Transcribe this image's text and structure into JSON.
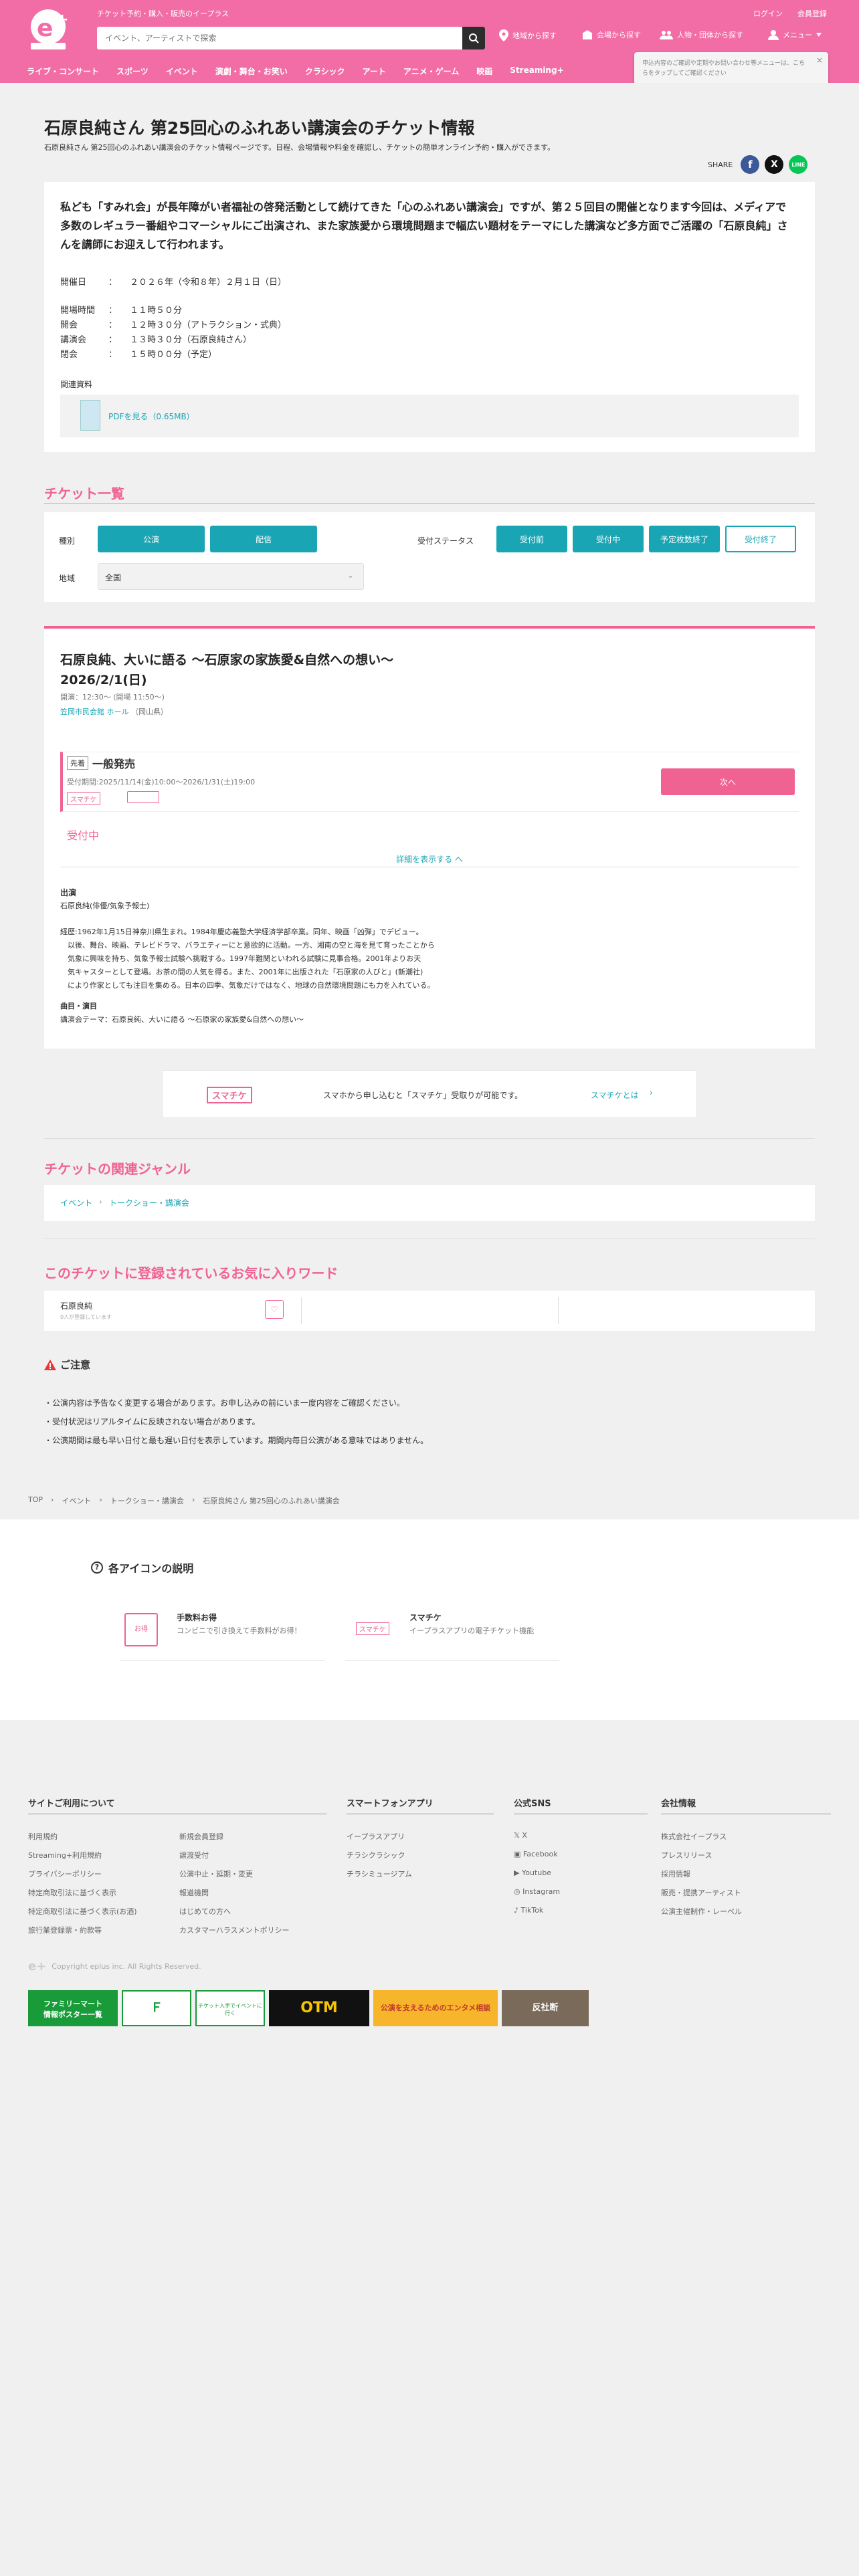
{
  "header": {
    "logo_text": "e+",
    "tagline": "チケット予約・購入・販売のイープラス",
    "search_placeholder": "イベント、アーティストで探索",
    "nav_area": "地域から探す",
    "nav_venue": "会場から探す",
    "nav_person": "人物・団体から探す",
    "nav_menu": "メニュー",
    "login": "ログイン",
    "register": "会員登録",
    "genres": [
      "ライブ・コンサート",
      "スポーツ",
      "イベント",
      "演劇・舞台・お笑い",
      "クラシック",
      "アート",
      "アニメ・ゲーム",
      "映画",
      "Streaming+"
    ],
    "popup": "申込内容のご確認や定期やお問い合わせ等メニューは、こちらをタップしてご確認ください"
  },
  "page": {
    "title": "石原良純さん 第25回心のふれあい講演会のチケット情報",
    "subtitle": "石原良純さん 第25回心のふれあい講演会のチケット情報ページです。日程、会場情報や料金を確認し、チケットの簡単オンライン予約・購入ができます。",
    "share": "SHARE"
  },
  "intro": {
    "text": "私ども「すみれ会」が長年障がい者福祉の啓発活動として続けてきた「心のふれあい講演会」ですが、第２５回目の開催となります今回は、メディアで多数のレギュラー番組やコマーシャルにご出演され、また家族愛から環境問題まで幅広い題材をテーマにした講演など多方面でご活躍の「石原良純」さんを講師にお迎えして行われます。",
    "schedule": [
      {
        "k": "開催日",
        "v": "２０２６年（令和８年）２月１日（日）"
      },
      {
        "k": "開場時間",
        "v": "１１時５０分"
      },
      {
        "k": "開会",
        "v": "１２時３０分（アトラクション・式典）"
      },
      {
        "k": "講演会",
        "v": "１３時３０分（石原良純さん）"
      },
      {
        "k": "閉会",
        "v": "１５時００分（予定）"
      }
    ],
    "colon": "：",
    "related_label": "関連資料",
    "pdf_link": "PDFを見る（0.65MB）"
  },
  "ticket_list": {
    "title": "チケット一覧",
    "type_label": "種別",
    "type_buttons": [
      "公演",
      "配信"
    ],
    "status_label": "受付ステータス",
    "status_buttons": [
      "受付前",
      "受付中",
      "予定枚数終了",
      "受付終了"
    ],
    "region_label": "地域",
    "region_value": "全国"
  },
  "event": {
    "title": "石原良純、大いに語る 〜石原家の家族愛&自然への想い〜",
    "date": "2026/2/1(日)",
    "times": "開演：12:30〜 (開場 11:50〜)",
    "venue": "笠岡市民会館 ホール",
    "prefecture": "（岡山県）",
    "sale_tag": "先着",
    "sale_type": "一般発売",
    "sale_period": "受付期間:2025/11/14(金)10:00〜2026/1/31(土)19:00",
    "sumachike_badge": "スマチケ",
    "next_button": "次へ",
    "status": "受付中",
    "details_link": "詳細を表示する へ",
    "cast_label": "出演",
    "cast": "石原良純(俳優/気象予報士)",
    "bio": "経歴:1962年1月15日神奈川県生まれ。1984年慶応義塾大学経済学部卒業。同年、映画「凶弾」でデビュー。\n　以後、舞台、映画、テレビドラマ、バラエティーにと意欲的に活動。一方、湘南の空と海を見て育ったことから\n　気象に興味を持ち、気象予報士試験へ挑戦する。1997年難関といわれる試験に見事合格。2001年よりお天\n　気キャスターとして登場。お茶の間の人気を得る。また、2001年に出版された「石原家の人びと」(新潮社)\n　により作家としても注目を集める。日本の四季、気象だけではなく、地球の自然環境問題にも力を入れている。",
    "program_label": "曲目・演目",
    "program": "講演会テーマ：石原良純、大いに語る 〜石原家の家族愛&自然への想い〜"
  },
  "sumachike_banner": {
    "badge": "スマチケ",
    "text": "スマホから申し込むと「スマチケ」受取りが可能です。",
    "link": "スマチケとは"
  },
  "related_genre": {
    "title": "チケットの関連ジャンル",
    "items": [
      "イベント",
      "トークショー・講演会"
    ]
  },
  "favorites": {
    "title": "このチケットに登録されているお気に入りワード",
    "word": "石原良純",
    "sub": "0人が登録しています"
  },
  "caution": {
    "title": "ご注意",
    "items": [
      "公演内容は予告なく変更する場合があります。お申し込みの前にいま一度内容をご確認ください。",
      "受付状況はリアルタイムに反映されない場合があります。",
      "公演期間は最も早い日付と最も遅い日付を表示しています。期間内毎日公演がある意味ではありません。"
    ]
  },
  "breadcrumb": [
    "TOP",
    "イベント",
    "トークショー・講演会",
    "石原良純さん 第25回心のふれあい講演会"
  ],
  "icon_help": {
    "title": "各アイコンの説明",
    "items": [
      {
        "icon": "お得",
        "name": "手数料お得",
        "desc": "コンビニで引き換えて手数料がお得！"
      },
      {
        "icon": "スマチケ",
        "name": "スマチケ",
        "desc": "イープラスアプリの電子チケット機能"
      }
    ]
  },
  "footer": {
    "col1_title": "サイトご利用について",
    "col1_links_a": [
      "利用規約",
      "Streaming+利用規約",
      "プライバシーポリシー",
      "特定商取引法に基づく表示",
      "特定商取引法に基づく表示(お酒)",
      "旅行業登録票・約款等"
    ],
    "col1_links_b": [
      "新規会員登録",
      "譲渡受付",
      "公演中止・延期・変更",
      "報道機関",
      "はじめての方へ",
      "カスタマーハラスメントポリシー"
    ],
    "col2_title": "スマートフォンアプリ",
    "col2_links": [
      "イープラスアプリ",
      "チラシクラシック",
      "チラシミュージアム"
    ],
    "col3_title": "公式SNS",
    "col3_links": [
      "X",
      "Facebook",
      "Youtube",
      "Instagram",
      "TikTok"
    ],
    "col4_title": "会社情報",
    "col4_links": [
      "株式会社イープラス",
      "プレスリリース",
      "採用情報",
      "販売・提携アーティスト",
      "公演主催制作・レーベル"
    ],
    "copyright": "Copyright eplus inc. All Rights Reserved.",
    "banners": [
      "ファミリーマート\n情報ポスター一覧",
      "Ｆ",
      "チケット入手でイベントに行く",
      "OTM",
      "公演を支えるためのエンタメ相談",
      "反社断"
    ]
  }
}
